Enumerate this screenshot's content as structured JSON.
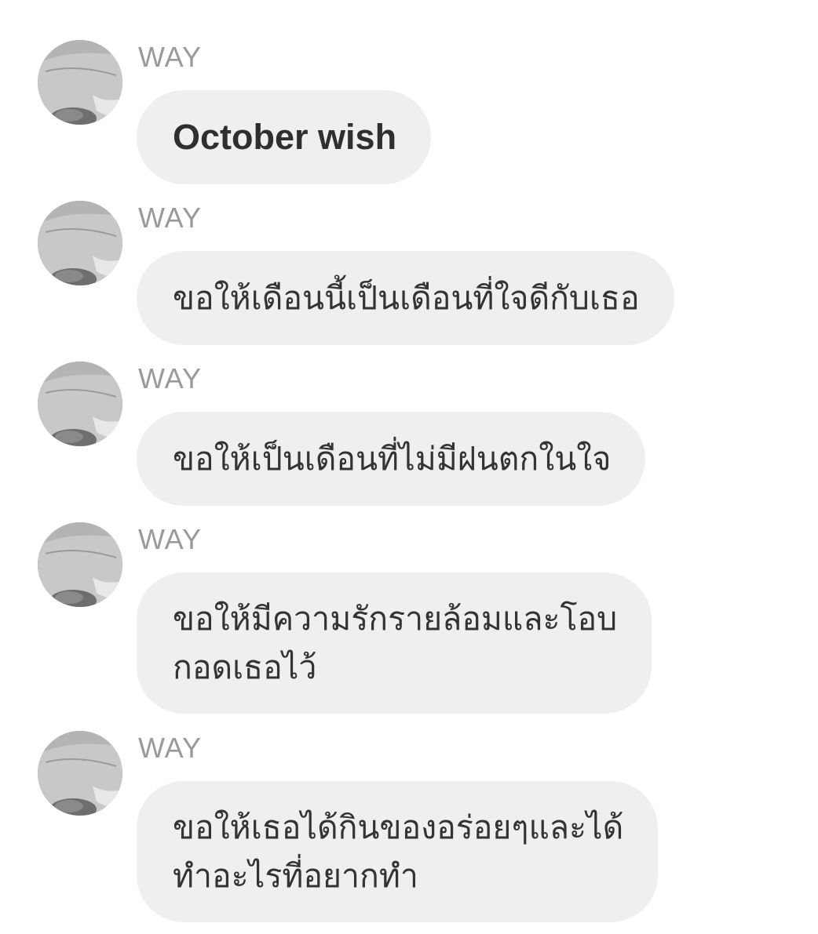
{
  "messages": [
    {
      "sender": "WAY",
      "text": "October wish",
      "style": "bold"
    },
    {
      "sender": "WAY",
      "text": "ขอให้เดือนนี้เป็นเดือนที่ใจดีกับเธอ",
      "style": "normal"
    },
    {
      "sender": "WAY",
      "text": "ขอให้เป็นเดือนที่ไม่มีฝนตกในใจ",
      "style": "normal"
    },
    {
      "sender": "WAY",
      "text": "ขอให้มีความรักรายล้อมและโอบ\nกอดเธอไว้",
      "style": "normal"
    },
    {
      "sender": "WAY",
      "text": "ขอให้เธอได้กินของอร่อยๆและได้\nทำอะไรที่อยากทำ",
      "style": "normal"
    }
  ],
  "colors": {
    "bubble_bg": "#efefef",
    "sender_text": "#9a9a9a",
    "message_text": "#333333",
    "background": "#ffffff"
  },
  "icons": {
    "avatar": "user-photo-avatar"
  }
}
